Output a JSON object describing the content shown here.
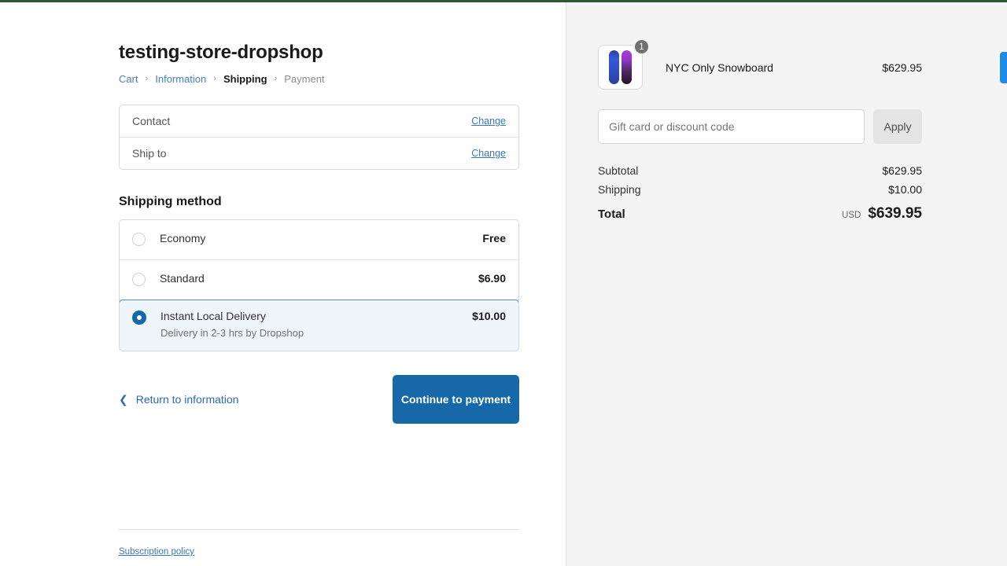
{
  "window": {
    "top_border_color": "#2d5b34",
    "accent_color": "#1668a8",
    "link_color": "#3a76bf",
    "side_tab_color": "#1e8ae8"
  },
  "header": {
    "store_title": "testing-store-dropshop"
  },
  "breadcrumb": {
    "separator": "›",
    "items": [
      {
        "label": "Cart",
        "state": "link"
      },
      {
        "label": "Information",
        "state": "link"
      },
      {
        "label": "Shipping",
        "state": "current"
      },
      {
        "label": "Payment",
        "state": "pending"
      }
    ]
  },
  "review": {
    "rows": [
      {
        "label": "Contact",
        "value": "",
        "action": "Change"
      },
      {
        "label": "Ship to",
        "value": "",
        "action": "Change"
      }
    ]
  },
  "shipping": {
    "section_title": "Shipping method",
    "options": [
      {
        "name": "Economy",
        "description": "",
        "price": "Free",
        "selected": false
      },
      {
        "name": "Standard",
        "description": "",
        "price": "$6.90",
        "selected": false
      },
      {
        "name": "Instant Local Delivery",
        "description": "Delivery in 2-3 hrs by Dropshop",
        "price": "$10.00",
        "selected": true
      }
    ]
  },
  "nav": {
    "return_label": "Return to information",
    "return_icon": "chevron-left-icon",
    "continue_label": "Continue to payment"
  },
  "footer": {
    "links": [
      {
        "label": "Subscription policy"
      }
    ]
  },
  "summary": {
    "line_items": [
      {
        "name": "NYC Only Snowboard",
        "price": "$629.95",
        "quantity": "1",
        "thumbnail": "snowboard-pair-image"
      }
    ],
    "discount": {
      "placeholder": "Gift card or discount code",
      "value": "",
      "apply_label": "Apply"
    },
    "totals": [
      {
        "label": "Subtotal",
        "value": "$629.95"
      },
      {
        "label": "Shipping",
        "value": "$10.00"
      }
    ],
    "grand_total": {
      "label": "Total",
      "currency": "USD",
      "value": "$639.95"
    }
  }
}
